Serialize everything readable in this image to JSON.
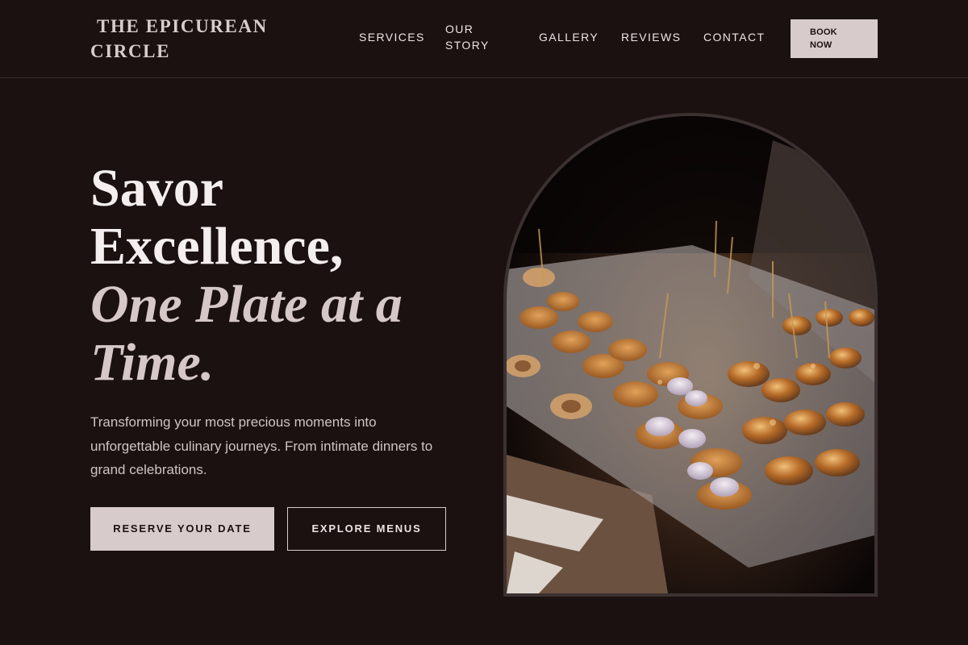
{
  "header": {
    "logo": "THE EPICUREAN CIRCLE",
    "nav": {
      "services": "SERVICES",
      "our_story": "OUR STORY",
      "gallery": "GALLERY",
      "reviews": "REVIEWS",
      "contact": "CONTACT"
    },
    "book_now": "BOOK NOW"
  },
  "hero": {
    "headline_line1": "Savor",
    "headline_line2": "Excellence,",
    "headline_italic": "One Plate at a Time.",
    "subtext": "Transforming your most precious moments into unforgettable culinary journeys. From intimate dinners to grand celebrations.",
    "primary_button": "RESERVE YOUR DATE",
    "secondary_button": "EXPLORE MENUS"
  },
  "colors": {
    "background": "#1b1111",
    "accent": "#d8cbcb",
    "text": "#efe8e8"
  }
}
